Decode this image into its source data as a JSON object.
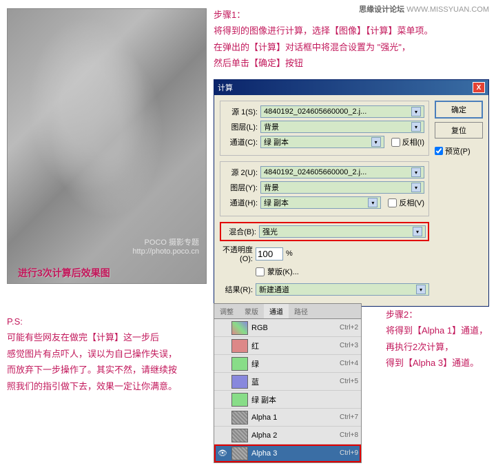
{
  "watermark": {
    "cn": "思缘设计论坛",
    "en": "WWW.MISSYUAN.COM"
  },
  "preview": {
    "logo": "POCO 摄影专题",
    "logo_url": "http://photo.poco.cn",
    "caption": "进行3次计算后效果图"
  },
  "step1": {
    "title": "步骤1：",
    "line1": "将得到的图像进行计算，选择【图像】【计算】菜单项。",
    "line2": "在弹出的【计算】对话框中将混合设置为 \"强光\"，",
    "line3": "然后单击【确定】按钮"
  },
  "ps": {
    "title": "P.S:",
    "line1": "可能有些网友在做完【计算】这一步后",
    "line2": "感觉图片有点吓人，误以为自己操作失误，",
    "line3": "而放弃下一步操作了。其实不然，请继续按",
    "line4": "照我们的指引做下去，效果一定让你满意。"
  },
  "step2": {
    "title": "步骤2：",
    "line1": "将得到【Alpha 1】通道，",
    "line2": "再执行2次计算，",
    "line3": "得到【Alpha 3】通道。"
  },
  "dialog": {
    "title": "计算",
    "close": "X",
    "ok": "确定",
    "reset": "复位",
    "preview": "预览(P)",
    "source1": {
      "legend": "源 1(S):",
      "file": "4840192_024605660000_2.j...",
      "layer_label": "图层(L):",
      "layer": "背景",
      "channel_label": "通道(C):",
      "channel": "绿 副本",
      "invert": "反相(I)"
    },
    "source2": {
      "legend": "源 2(U):",
      "file": "4840192_024605660000_2.j...",
      "layer_label": "图层(Y):",
      "layer": "背景",
      "channel_label": "通道(H):",
      "channel": "绿 副本",
      "invert": "反相(V)"
    },
    "blend_label": "混合(B):",
    "blend": "强光",
    "opacity_label": "不透明度(O):",
    "opacity": "100",
    "percent": "%",
    "mask": "蒙版(K)...",
    "result_label": "结果(R):",
    "result": "新建通道"
  },
  "channels": {
    "tabs": [
      "调整",
      "蒙版",
      "通道",
      "路径"
    ],
    "active_tab": 2,
    "rows": [
      {
        "name": "RGB",
        "shortcut": "Ctrl+2",
        "thumb": "rgb",
        "eye": false
      },
      {
        "name": "红",
        "shortcut": "Ctrl+3",
        "thumb": "r",
        "eye": false
      },
      {
        "name": "绿",
        "shortcut": "Ctrl+4",
        "thumb": "g",
        "eye": false
      },
      {
        "name": "蓝",
        "shortcut": "Ctrl+5",
        "thumb": "b",
        "eye": false
      },
      {
        "name": "绿 副本",
        "shortcut": "",
        "thumb": "g",
        "eye": false
      },
      {
        "name": "Alpha 1",
        "shortcut": "Ctrl+7",
        "thumb": "alpha",
        "eye": false
      },
      {
        "name": "Alpha 2",
        "shortcut": "Ctrl+8",
        "thumb": "alpha",
        "eye": false
      },
      {
        "name": "Alpha 3",
        "shortcut": "Ctrl+9",
        "thumb": "alpha",
        "eye": true,
        "selected": true,
        "highlight": true
      }
    ]
  }
}
